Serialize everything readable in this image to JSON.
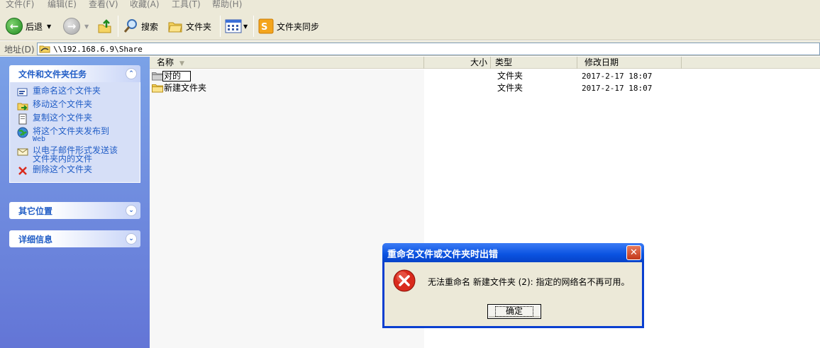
{
  "menu": {
    "items": [
      "文件(F)",
      "编辑(E)",
      "查看(V)",
      "收藏(A)",
      "工具(T)",
      "帮助(H)"
    ]
  },
  "toolbar": {
    "back_label": "后退",
    "search_label": "搜索",
    "folders_label": "文件夹",
    "sync_label": "文件夹同步",
    "icons": [
      "back-arrow-icon",
      "forward-arrow-icon",
      "up-folder-icon",
      "search-magnifier-icon",
      "folders-icon",
      "views-icon",
      "folder-sync-icon"
    ]
  },
  "address": {
    "label": "地址(D)",
    "value": "\\\\192.168.6.9\\Share"
  },
  "taskpane": {
    "tasks": {
      "title": "文件和文件夹任务",
      "items": [
        {
          "label": "重命名这个文件夹",
          "icon": "rename-icon"
        },
        {
          "label": "移动这个文件夹",
          "icon": "move-icon"
        },
        {
          "label": "复制这个文件夹",
          "icon": "copy-icon"
        },
        {
          "label": "将这个文件夹发布到",
          "sub": "Web",
          "icon": "publish-web-icon"
        },
        {
          "label": "以电子邮件形式发送该",
          "sub2": "文件夹内的文件",
          "icon": "email-icon"
        },
        {
          "label": "删除这个文件夹",
          "icon": "delete-icon"
        }
      ]
    },
    "other_places": {
      "title": "其它位置"
    },
    "details": {
      "title": "详细信息"
    }
  },
  "filelist": {
    "columns": {
      "name": "名称",
      "size": "大小",
      "type": "类型",
      "modified": "修改日期"
    },
    "rows": [
      {
        "name": "对的",
        "type": "文件夹",
        "modified": "2017-2-17 18:07",
        "editing": true
      },
      {
        "name": "新建文件夹",
        "type": "文件夹",
        "modified": "2017-2-17 18:07"
      }
    ]
  },
  "dialog": {
    "title": "重命名文件或文件夹时出错",
    "message": "无法重命名 新建文件夹 (2): 指定的网络名不再可用。",
    "ok_label": "确定",
    "close_glyph": "✕"
  },
  "colors": {
    "taskpane_link": "#215dc6",
    "taskpane_bg": "#6f8ce0",
    "titlebar": "#0a52e0",
    "error_red": "#d92a1c"
  }
}
